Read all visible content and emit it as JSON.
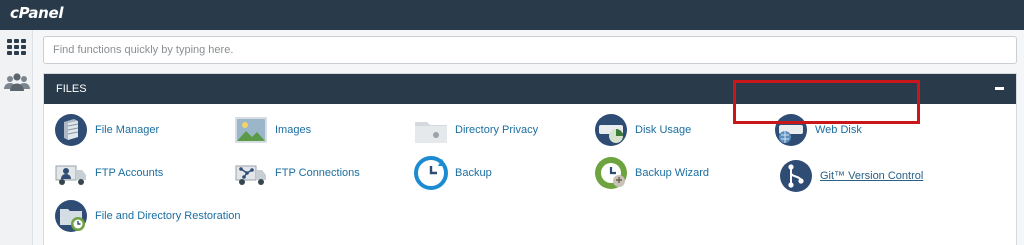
{
  "header": {
    "logo": "cPanel"
  },
  "search": {
    "placeholder": "Find functions quickly by typing here."
  },
  "section": {
    "title": "FILES"
  },
  "items": [
    {
      "label": "File Manager",
      "icon": "file-manager-icon"
    },
    {
      "label": "Images",
      "icon": "images-icon"
    },
    {
      "label": "Directory Privacy",
      "icon": "directory-privacy-icon"
    },
    {
      "label": "Disk Usage",
      "icon": "disk-usage-icon"
    },
    {
      "label": "Web Disk",
      "icon": "web-disk-icon"
    },
    {
      "label": "FTP Accounts",
      "icon": "ftp-accounts-icon"
    },
    {
      "label": "FTP Connections",
      "icon": "ftp-connections-icon"
    },
    {
      "label": "Backup",
      "icon": "backup-icon"
    },
    {
      "label": "Backup Wizard",
      "icon": "backup-wizard-icon"
    },
    {
      "label": "Git™ Version Control",
      "icon": "git-version-control-icon"
    },
    {
      "label": "File and Directory Restoration",
      "icon": "file-directory-restoration-icon"
    }
  ],
  "colors": {
    "header_bg": "#293a4a",
    "link": "#1b6ea0",
    "highlight_border": "#c8161b"
  }
}
